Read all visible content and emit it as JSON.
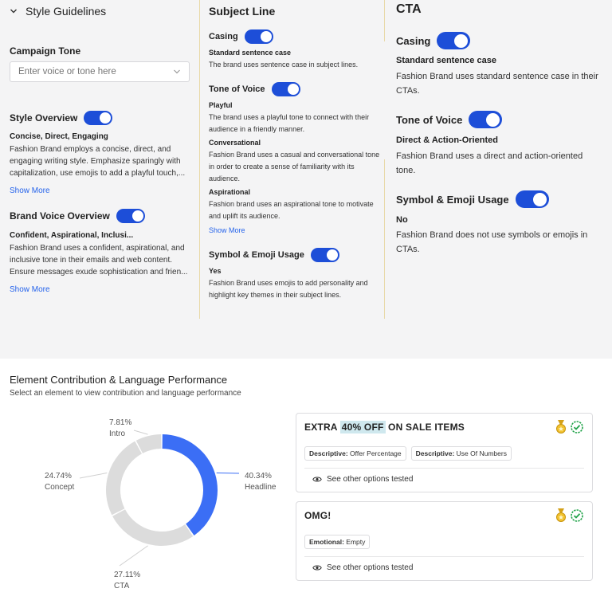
{
  "style_guidelines": {
    "header": "Style Guidelines",
    "campaign_tone_label": "Campaign Tone",
    "campaign_tone_placeholder": "Enter voice or tone here",
    "style_overview": {
      "title": "Style Overview",
      "summary": "Concise, Direct, Engaging",
      "text": "Fashion Brand employs a concise, direct, and engaging writing style. Emphasize sparingly with capitalization, use emojis to add a playful touch,...",
      "show_more": "Show More"
    },
    "brand_voice": {
      "title": "Brand Voice Overview",
      "summary": "Confident, Aspirational, Inclusi...",
      "text": "Fashion Brand uses a confident, aspirational, and inclusive tone in their emails and web content. Ensure messages exude sophistication and frien...",
      "show_more": "Show More"
    }
  },
  "subject_line": {
    "header": "Subject Line",
    "casing": {
      "title": "Casing",
      "value": "Standard sentence case",
      "text": "The brand uses sentence case in subject lines."
    },
    "tone": {
      "title": "Tone of Voice",
      "items": [
        {
          "name": "Playful",
          "text": "The brand uses a playful tone to connect with their audience in a friendly manner."
        },
        {
          "name": "Conversational",
          "text": "Fashion Brand uses a casual and conversational tone in order to create a sense of familiarity with its audience."
        },
        {
          "name": "Aspirational",
          "text": "Fashion brand uses an aspirational tone to motivate and uplift its audience."
        }
      ],
      "show_more": "Show More"
    },
    "symbol": {
      "title": "Symbol & Emoji Usage",
      "value": "Yes",
      "text": "Fashion Brand uses emojis to add personality and highlight key themes in their subject lines."
    }
  },
  "cta": {
    "header": "CTA",
    "casing": {
      "title": "Casing",
      "value": "Standard sentence case",
      "text": "Fashion Brand uses standard sentence case in their CTAs."
    },
    "tone": {
      "title": "Tone of Voice",
      "value": "Direct & Action-Oriented",
      "text": "Fashion Brand uses a direct and action-oriented tone."
    },
    "symbol": {
      "title": "Symbol & Emoji Usage",
      "value": "No",
      "text": "Fashion Brand does not use symbols or emojis in CTAs."
    }
  },
  "performance": {
    "title": "Element Contribution & Language Performance",
    "subtitle": "Select an element to view contribution and language performance",
    "cards": [
      {
        "title_pre": "EXTRA ",
        "title_hl": "40% OFF",
        "title_post": " ON SALE ITEMS",
        "tags": [
          {
            "key": "Descriptive:",
            "value": "Offer Percentage"
          },
          {
            "key": "Descriptive:",
            "value": "Use Of Numbers"
          }
        ],
        "see_other": "See other options tested"
      },
      {
        "title_pre": "OMG!",
        "title_hl": "",
        "title_post": "",
        "tags": [
          {
            "key": "Emotional:",
            "value": "Empty"
          }
        ],
        "see_other": "See other options tested"
      }
    ]
  },
  "chart_data": {
    "type": "pie",
    "variant": "donut",
    "slices": [
      {
        "label": "Headline",
        "pct_label": "40.34%",
        "value": 40.34,
        "color": "#3b6ef5"
      },
      {
        "label": "CTA",
        "pct_label": "27.11%",
        "value": 27.11,
        "color": "#dcdcdc"
      },
      {
        "label": "Concept",
        "pct_label": "24.74%",
        "value": 24.74,
        "color": "#dcdcdc"
      },
      {
        "label": "Intro",
        "pct_label": "7.81%",
        "value": 7.81,
        "color": "#dcdcdc"
      }
    ]
  }
}
